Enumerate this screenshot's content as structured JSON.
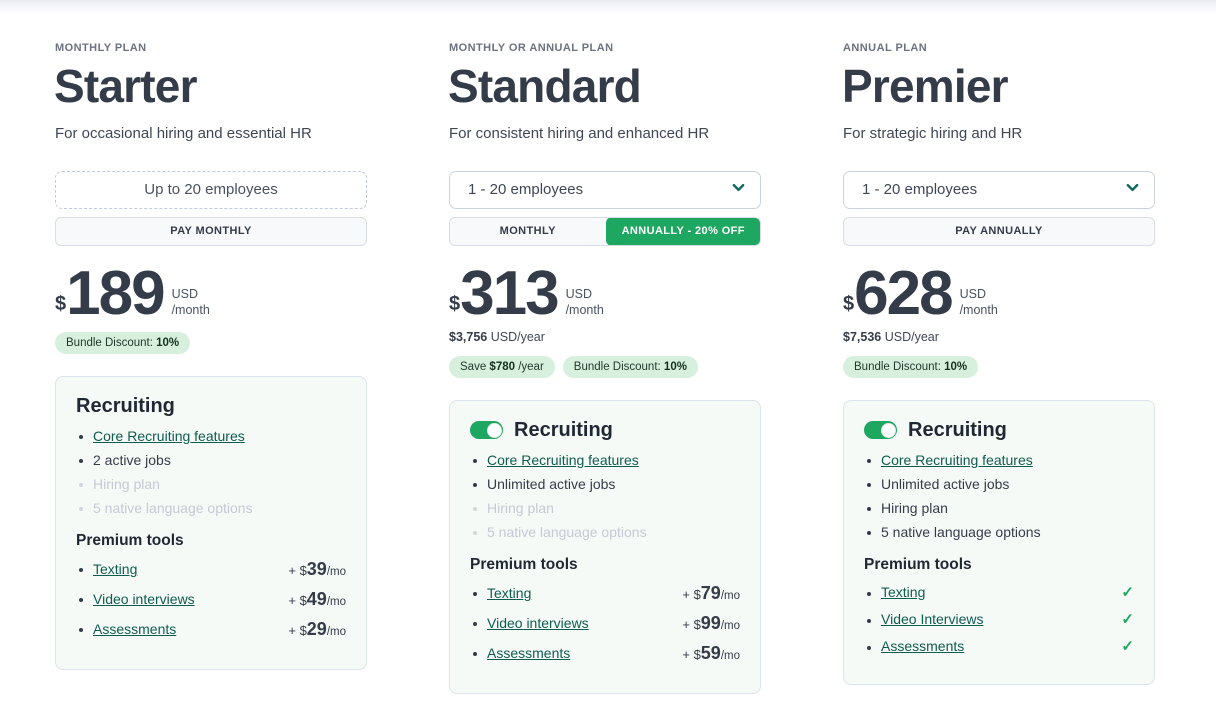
{
  "plans": [
    {
      "kicker": "MONTHLY PLAN",
      "name": "Starter",
      "tagline": "For occasional hiring and essential HR",
      "size_selector": {
        "type": "static",
        "label": "Up to 20 employees",
        "icon": ""
      },
      "billing": {
        "type": "static",
        "label": "PAY MONTHLY"
      },
      "price": {
        "currency": "$",
        "amount": "189",
        "unit_currency": "USD",
        "unit_period": "/month"
      },
      "yearly": "",
      "pills": [
        {
          "prefix": "Bundle Discount: ",
          "strong": "10%",
          "suffix": ""
        }
      ],
      "card": {
        "toggle": false,
        "title": "Recruiting",
        "features": [
          {
            "label": "Core Recruiting features",
            "link": true,
            "muted": false
          },
          {
            "label": "2 active jobs",
            "link": false,
            "muted": false
          },
          {
            "label": "Hiring plan",
            "link": false,
            "muted": true
          },
          {
            "label": "5 native language options",
            "link": false,
            "muted": true
          }
        ],
        "tools_title": "Premium tools",
        "tools": [
          {
            "label": "Texting",
            "price_prefix": "+ $",
            "price": "39",
            "price_suffix": "/mo",
            "included": false
          },
          {
            "label": "Video interviews",
            "price_prefix": "+ $",
            "price": "49",
            "price_suffix": "/mo",
            "included": false
          },
          {
            "label": "Assessments",
            "price_prefix": "+ $",
            "price": "29",
            "price_suffix": "/mo",
            "included": false
          }
        ]
      }
    },
    {
      "kicker": "MONTHLY OR ANNUAL PLAN",
      "name": "Standard",
      "tagline": "For consistent hiring and enhanced HR",
      "size_selector": {
        "type": "dropdown",
        "label": "1 - 20 employees",
        "icon": "chevron-down-icon"
      },
      "billing": {
        "type": "toggle",
        "options": [
          "MONTHLY",
          "ANNUALLY - 20% OFF"
        ],
        "selected": "ANNUALLY - 20% OFF"
      },
      "price": {
        "currency": "$",
        "amount": "313",
        "unit_currency": "USD",
        "unit_period": "/month"
      },
      "yearly": {
        "strong": "$3,756",
        "rest": " USD/year"
      },
      "pills": [
        {
          "prefix": "Save ",
          "strong": "$780",
          "suffix": " /year"
        },
        {
          "prefix": "Bundle Discount: ",
          "strong": "10%",
          "suffix": ""
        }
      ],
      "card": {
        "toggle": true,
        "title": "Recruiting",
        "features": [
          {
            "label": "Core Recruiting features",
            "link": true,
            "muted": false
          },
          {
            "label": "Unlimited active jobs",
            "link": false,
            "muted": false
          },
          {
            "label": "Hiring plan",
            "link": false,
            "muted": true
          },
          {
            "label": "5 native language options",
            "link": false,
            "muted": true
          }
        ],
        "tools_title": "Premium tools",
        "tools": [
          {
            "label": "Texting",
            "price_prefix": "+ $",
            "price": "79",
            "price_suffix": "/mo",
            "included": false
          },
          {
            "label": "Video interviews",
            "price_prefix": "+ $",
            "price": "99",
            "price_suffix": "/mo",
            "included": false
          },
          {
            "label": "Assessments",
            "price_prefix": "+ $",
            "price": "59",
            "price_suffix": "/mo",
            "included": false
          }
        ]
      }
    },
    {
      "kicker": "ANNUAL PLAN",
      "name": "Premier",
      "tagline": "For strategic hiring and HR",
      "size_selector": {
        "type": "dropdown",
        "label": "1 - 20 employees",
        "icon": "chevron-down-icon"
      },
      "billing": {
        "type": "static",
        "label": "PAY ANNUALLY"
      },
      "price": {
        "currency": "$",
        "amount": "628",
        "unit_currency": "USD",
        "unit_period": "/month"
      },
      "yearly": {
        "strong": "$7,536",
        "rest": " USD/year"
      },
      "pills": [
        {
          "prefix": "Bundle Discount: ",
          "strong": "10%",
          "suffix": ""
        }
      ],
      "card": {
        "toggle": true,
        "title": "Recruiting",
        "features": [
          {
            "label": "Core Recruiting features",
            "link": true,
            "muted": false
          },
          {
            "label": "Unlimited active jobs",
            "link": false,
            "muted": false
          },
          {
            "label": "Hiring plan",
            "link": false,
            "muted": false
          },
          {
            "label": "5 native language options",
            "link": false,
            "muted": false
          }
        ],
        "tools_title": "Premium tools",
        "tools": [
          {
            "label": "Texting",
            "price_prefix": "",
            "price": "",
            "price_suffix": "",
            "included": true
          },
          {
            "label": "Video Interviews",
            "price_prefix": "",
            "price": "",
            "price_suffix": "",
            "included": true
          },
          {
            "label": "Assessments",
            "price_prefix": "",
            "price": "",
            "price_suffix": "",
            "included": true
          }
        ]
      }
    }
  ],
  "colors": {
    "accent_green": "#1ea761",
    "link_teal": "#0e5c50",
    "heading_dark": "#343c49",
    "pill_bg": "#d6f0dd",
    "card_bg": "#f6faf6"
  },
  "icons": {
    "check": "✓",
    "chevron_down": "⌄"
  }
}
